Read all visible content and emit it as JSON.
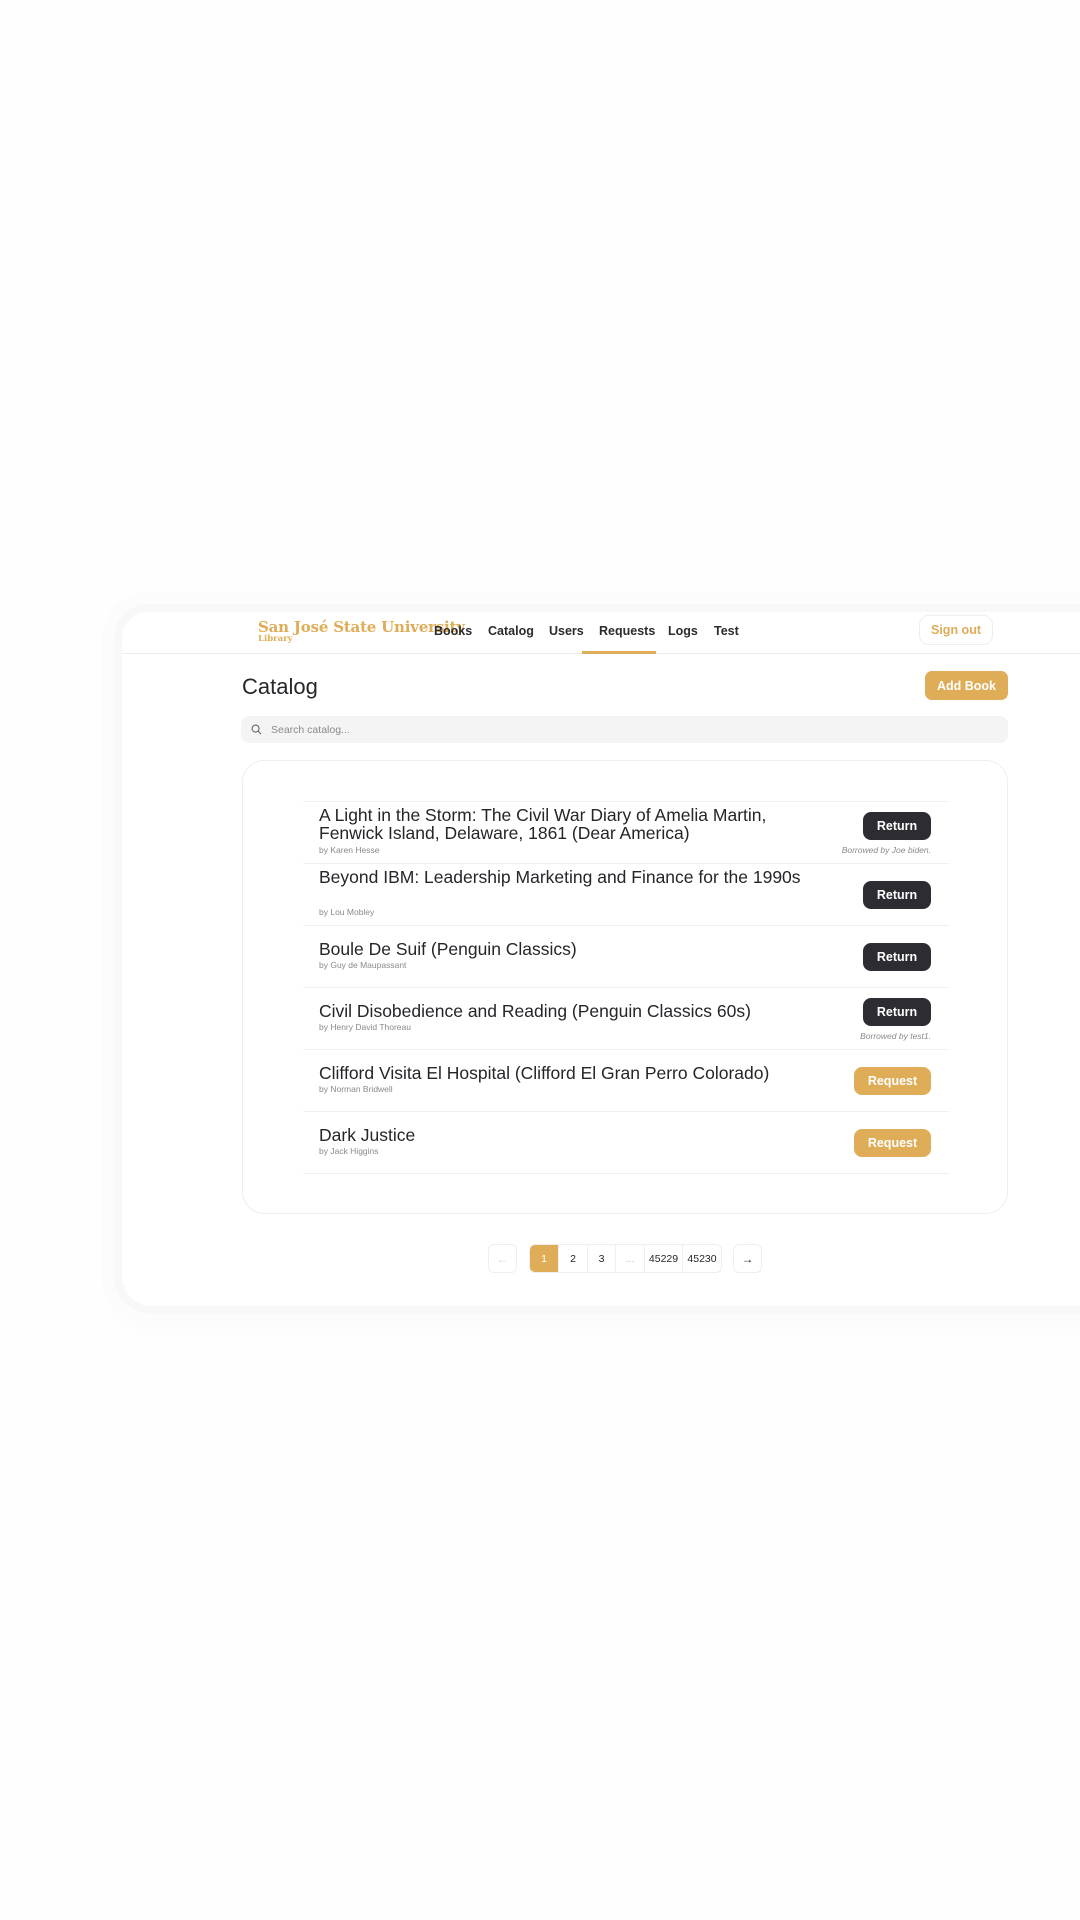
{
  "brand": {
    "name": "San José State University",
    "subtitle": "Library",
    "accent_color": "#dfac57",
    "dark_button_color": "#2d2c33"
  },
  "nav": {
    "items": [
      {
        "label": "Books",
        "active": false
      },
      {
        "label": "Catalog",
        "active": true
      },
      {
        "label": "Users",
        "active": false
      },
      {
        "label": "Requests",
        "active": false
      },
      {
        "label": "Logs",
        "active": false
      },
      {
        "label": "Test",
        "active": false
      }
    ],
    "sign_out_label": "Sign out"
  },
  "page": {
    "title": "Catalog",
    "add_book_label": "Add Book"
  },
  "search": {
    "icon": "search-icon",
    "value": "",
    "placeholder": "Search catalog..."
  },
  "books": [
    {
      "title": "A Light in the Storm: The Civil War Diary of Amelia Martin, Fenwick Island, Delaware, 1861 (Dear America)",
      "author": "by Karen Hesse",
      "action": "Return",
      "borrowed_note": "Borrowed by Joe biden."
    },
    {
      "title": "Beyond IBM: Leadership Marketing and Finance for the 1990s",
      "author": "by Lou Mobley",
      "action": "Return",
      "borrowed_note": ""
    },
    {
      "title": "Boule De Suif (Penguin Classics)",
      "author": "by Guy de Maupassant",
      "action": "Return",
      "borrowed_note": ""
    },
    {
      "title": "Civil Disobedience and Reading (Penguin Classics 60s)",
      "author": "by Henry David Thoreau",
      "action": "Return",
      "borrowed_note": "Borrowed by test1."
    },
    {
      "title": "Clifford Visita El Hospital (Clifford El Gran Perro Colorado)",
      "author": "by Norman Bridwell",
      "action": "Request",
      "borrowed_note": ""
    },
    {
      "title": "Dark Justice",
      "author": "by Jack Higgins",
      "action": "Request",
      "borrowed_note": ""
    }
  ],
  "pagination": {
    "prev_icon": "←",
    "next_icon": "→",
    "pages": [
      "1",
      "2",
      "3",
      "...",
      "45229",
      "45230"
    ],
    "current": "1"
  }
}
